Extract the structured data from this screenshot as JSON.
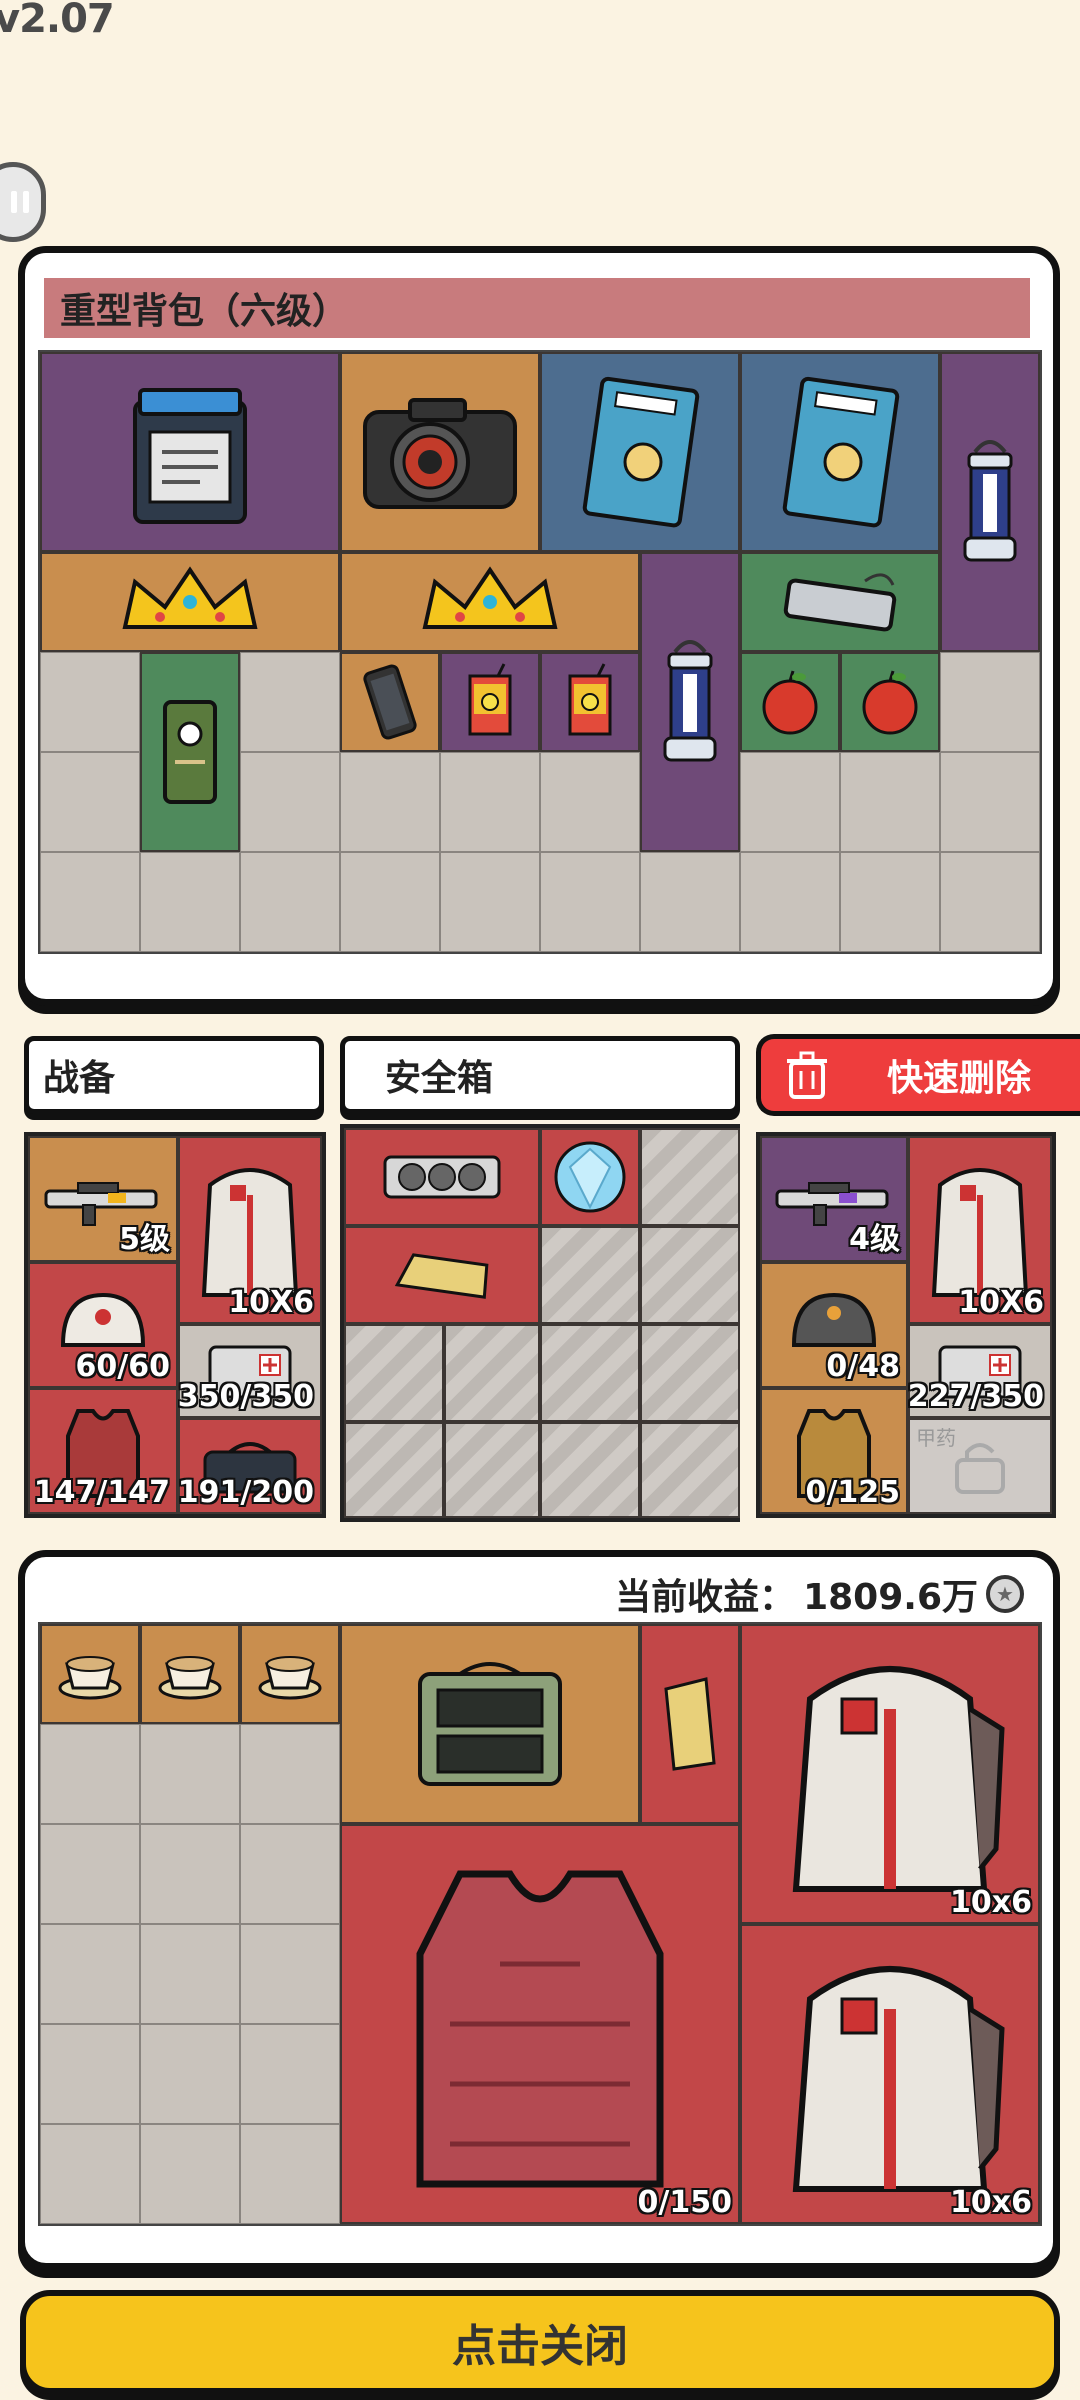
{
  "version": "v2.07",
  "backpack": {
    "title": "重型背包（六级）"
  },
  "tabs": {
    "gear": "战备",
    "safe_box": "安全箱",
    "quick_delete": "快速删除"
  },
  "gear_left": {
    "weapon_level": "5级",
    "backpack_size": "10X6",
    "helmet_durability": "60/60",
    "medkit": "350/350",
    "vest_durability": "147/147",
    "bag": "191/200"
  },
  "gear_right": {
    "weapon_level": "4级",
    "backpack_size": "10X6",
    "helmet_durability": "0/48",
    "medkit": "227/350",
    "vest_durability": "0/125",
    "locked_label": "甲药"
  },
  "loot": {
    "earnings_label": "当前收益：",
    "earnings_value": "1809.6万",
    "vest_durability": "0/150",
    "backpack1_size": "10x6",
    "backpack2_size": "10x6"
  },
  "close_button": "点击关闭",
  "colors": {
    "rarity_purple": "#6f4a78",
    "rarity_orange": "#c98e4e",
    "rarity_blue": "#4d6d8f",
    "rarity_green": "#4f8a5c",
    "rarity_red": "#c24748",
    "close_yellow": "#f6c41c",
    "delete_red": "#ee3d3d"
  }
}
